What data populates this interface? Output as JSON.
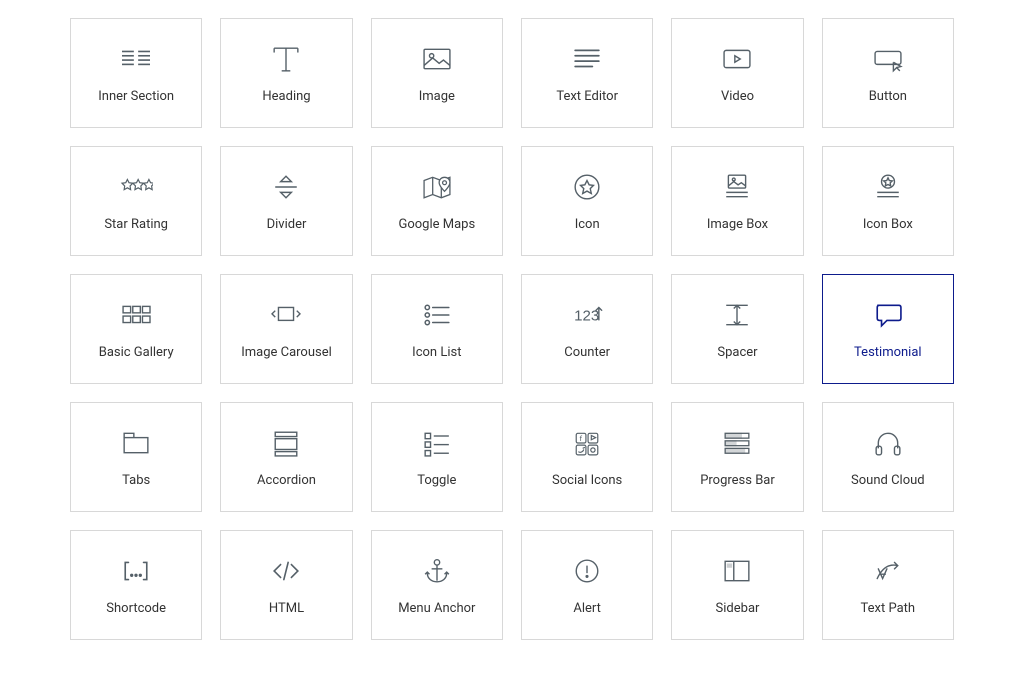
{
  "widgets": [
    {
      "id": "inner-section",
      "label": "Inner Section",
      "icon": "inner-section-icon",
      "selected": false
    },
    {
      "id": "heading",
      "label": "Heading",
      "icon": "heading-icon",
      "selected": false
    },
    {
      "id": "image",
      "label": "Image",
      "icon": "image-icon",
      "selected": false
    },
    {
      "id": "text-editor",
      "label": "Text Editor",
      "icon": "text-editor-icon",
      "selected": false
    },
    {
      "id": "video",
      "label": "Video",
      "icon": "video-icon",
      "selected": false
    },
    {
      "id": "button",
      "label": "Button",
      "icon": "button-icon",
      "selected": false
    },
    {
      "id": "star-rating",
      "label": "Star Rating",
      "icon": "star-rating-icon",
      "selected": false
    },
    {
      "id": "divider",
      "label": "Divider",
      "icon": "divider-icon",
      "selected": false
    },
    {
      "id": "google-maps",
      "label": "Google Maps",
      "icon": "google-maps-icon",
      "selected": false
    },
    {
      "id": "icon",
      "label": "Icon",
      "icon": "star-circle-icon",
      "selected": false
    },
    {
      "id": "image-box",
      "label": "Image Box",
      "icon": "image-box-icon",
      "selected": false
    },
    {
      "id": "icon-box",
      "label": "Icon Box",
      "icon": "icon-box-icon",
      "selected": false
    },
    {
      "id": "basic-gallery",
      "label": "Basic Gallery",
      "icon": "gallery-icon",
      "selected": false
    },
    {
      "id": "image-carousel",
      "label": "Image Carousel",
      "icon": "carousel-icon",
      "selected": false
    },
    {
      "id": "icon-list",
      "label": "Icon List",
      "icon": "icon-list-icon",
      "selected": false
    },
    {
      "id": "counter",
      "label": "Counter",
      "icon": "counter-icon",
      "selected": false
    },
    {
      "id": "spacer",
      "label": "Spacer",
      "icon": "spacer-icon",
      "selected": false
    },
    {
      "id": "testimonial",
      "label": "Testimonial",
      "icon": "testimonial-icon",
      "selected": true
    },
    {
      "id": "tabs",
      "label": "Tabs",
      "icon": "tabs-icon",
      "selected": false
    },
    {
      "id": "accordion",
      "label": "Accordion",
      "icon": "accordion-icon",
      "selected": false
    },
    {
      "id": "toggle",
      "label": "Toggle",
      "icon": "toggle-icon",
      "selected": false
    },
    {
      "id": "social-icons",
      "label": "Social Icons",
      "icon": "social-icons-icon",
      "selected": false
    },
    {
      "id": "progress-bar",
      "label": "Progress Bar",
      "icon": "progress-bar-icon",
      "selected": false
    },
    {
      "id": "sound-cloud",
      "label": "Sound Cloud",
      "icon": "headphones-icon",
      "selected": false
    },
    {
      "id": "shortcode",
      "label": "Shortcode",
      "icon": "shortcode-icon",
      "selected": false
    },
    {
      "id": "html",
      "label": "HTML",
      "icon": "code-icon",
      "selected": false
    },
    {
      "id": "menu-anchor",
      "label": "Menu Anchor",
      "icon": "anchor-icon",
      "selected": false
    },
    {
      "id": "alert",
      "label": "Alert",
      "icon": "alert-icon",
      "selected": false
    },
    {
      "id": "sidebar",
      "label": "Sidebar",
      "icon": "sidebar-icon",
      "selected": false
    },
    {
      "id": "text-path",
      "label": "Text Path",
      "icon": "text-path-icon",
      "selected": false
    }
  ]
}
